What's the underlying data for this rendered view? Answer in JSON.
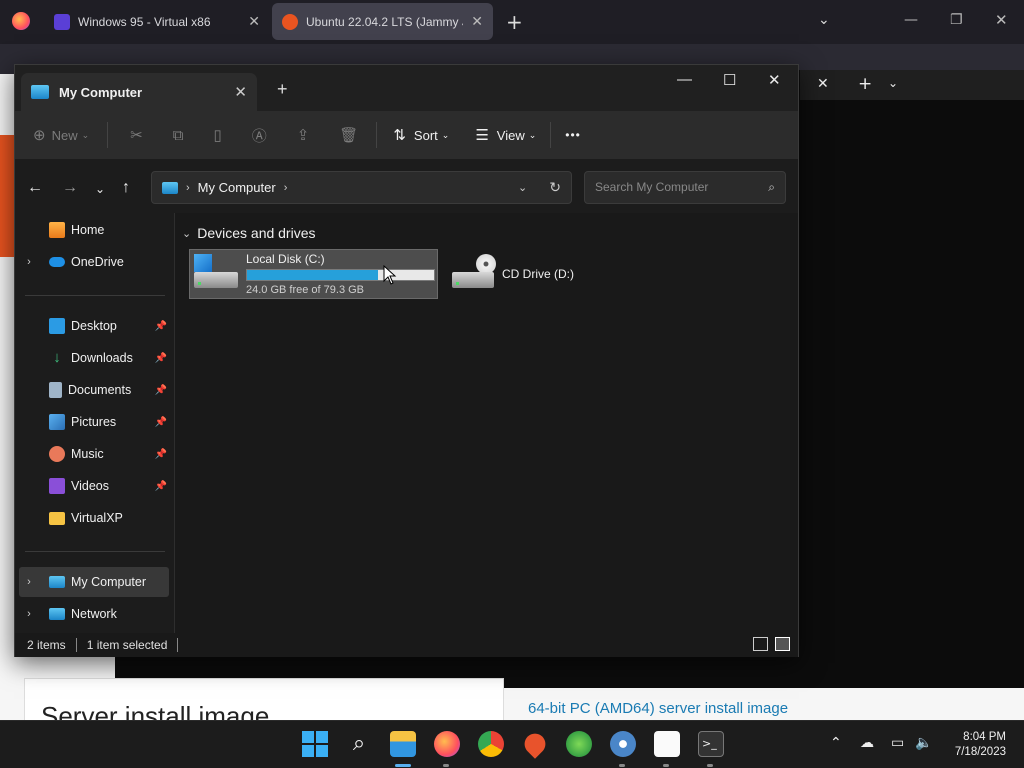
{
  "browser": {
    "tabs": [
      {
        "label": "Windows 95 - Virtual x86",
        "active": false
      },
      {
        "label": "Ubuntu 22.04.2 LTS (Jammy Jell",
        "active": true
      }
    ],
    "new_tab_glyph": "+",
    "menu_glyph": "⌄"
  },
  "page": {
    "heading": "Server install image",
    "link": "64-bit PC (AMD64) server install image",
    "accent_color": "#e95420",
    "link_color": "#1a7bb3"
  },
  "explorer": {
    "tab_title": "My Computer",
    "toolbar": {
      "new": "New",
      "sort": "Sort",
      "view": "View",
      "more": "•••"
    },
    "address": {
      "path": "My Computer",
      "search_placeholder": "Search My Computer"
    },
    "sidebar": {
      "items": [
        {
          "label": "Home",
          "icon": "home-icon",
          "pinned": false,
          "chevron": false
        },
        {
          "label": "OneDrive",
          "icon": "cloud-icon",
          "pinned": false,
          "chevron": true
        },
        {
          "label": "Desktop",
          "icon": "desktop-icon",
          "pinned": true,
          "chevron": false
        },
        {
          "label": "Downloads",
          "icon": "download-icon",
          "pinned": true,
          "chevron": false
        },
        {
          "label": "Documents",
          "icon": "document-icon",
          "pinned": true,
          "chevron": false
        },
        {
          "label": "Pictures",
          "icon": "picture-icon",
          "pinned": true,
          "chevron": false
        },
        {
          "label": "Music",
          "icon": "music-icon",
          "pinned": true,
          "chevron": false
        },
        {
          "label": "Videos",
          "icon": "video-icon",
          "pinned": true,
          "chevron": false
        },
        {
          "label": "VirtualXP",
          "icon": "folder-icon",
          "pinned": false,
          "chevron": false
        },
        {
          "label": "My Computer",
          "icon": "computer-icon",
          "pinned": false,
          "chevron": true,
          "selected": true
        },
        {
          "label": "Network",
          "icon": "network-icon",
          "pinned": false,
          "chevron": true
        }
      ]
    },
    "group_header": "Devices and drives",
    "drives": [
      {
        "name": "Local Disk (C:)",
        "free_text": "24.0 GB free of 79.3 GB",
        "used_fraction": 0.7,
        "selected": true
      },
      {
        "name": "CD Drive (D:)",
        "selected": false
      }
    ],
    "status": {
      "items": "2 items",
      "selected": "1 item selected"
    }
  },
  "taskbar": {
    "apps": [
      "start-icon",
      "search-icon",
      "file-explorer-icon",
      "firefox-icon",
      "chrome-icon",
      "maps-icon",
      "network-globe-icon",
      "settings-icon",
      "solitaire-icon",
      "terminal-icon"
    ],
    "clock": {
      "time": "8:04 PM",
      "date": "7/18/2023"
    }
  }
}
